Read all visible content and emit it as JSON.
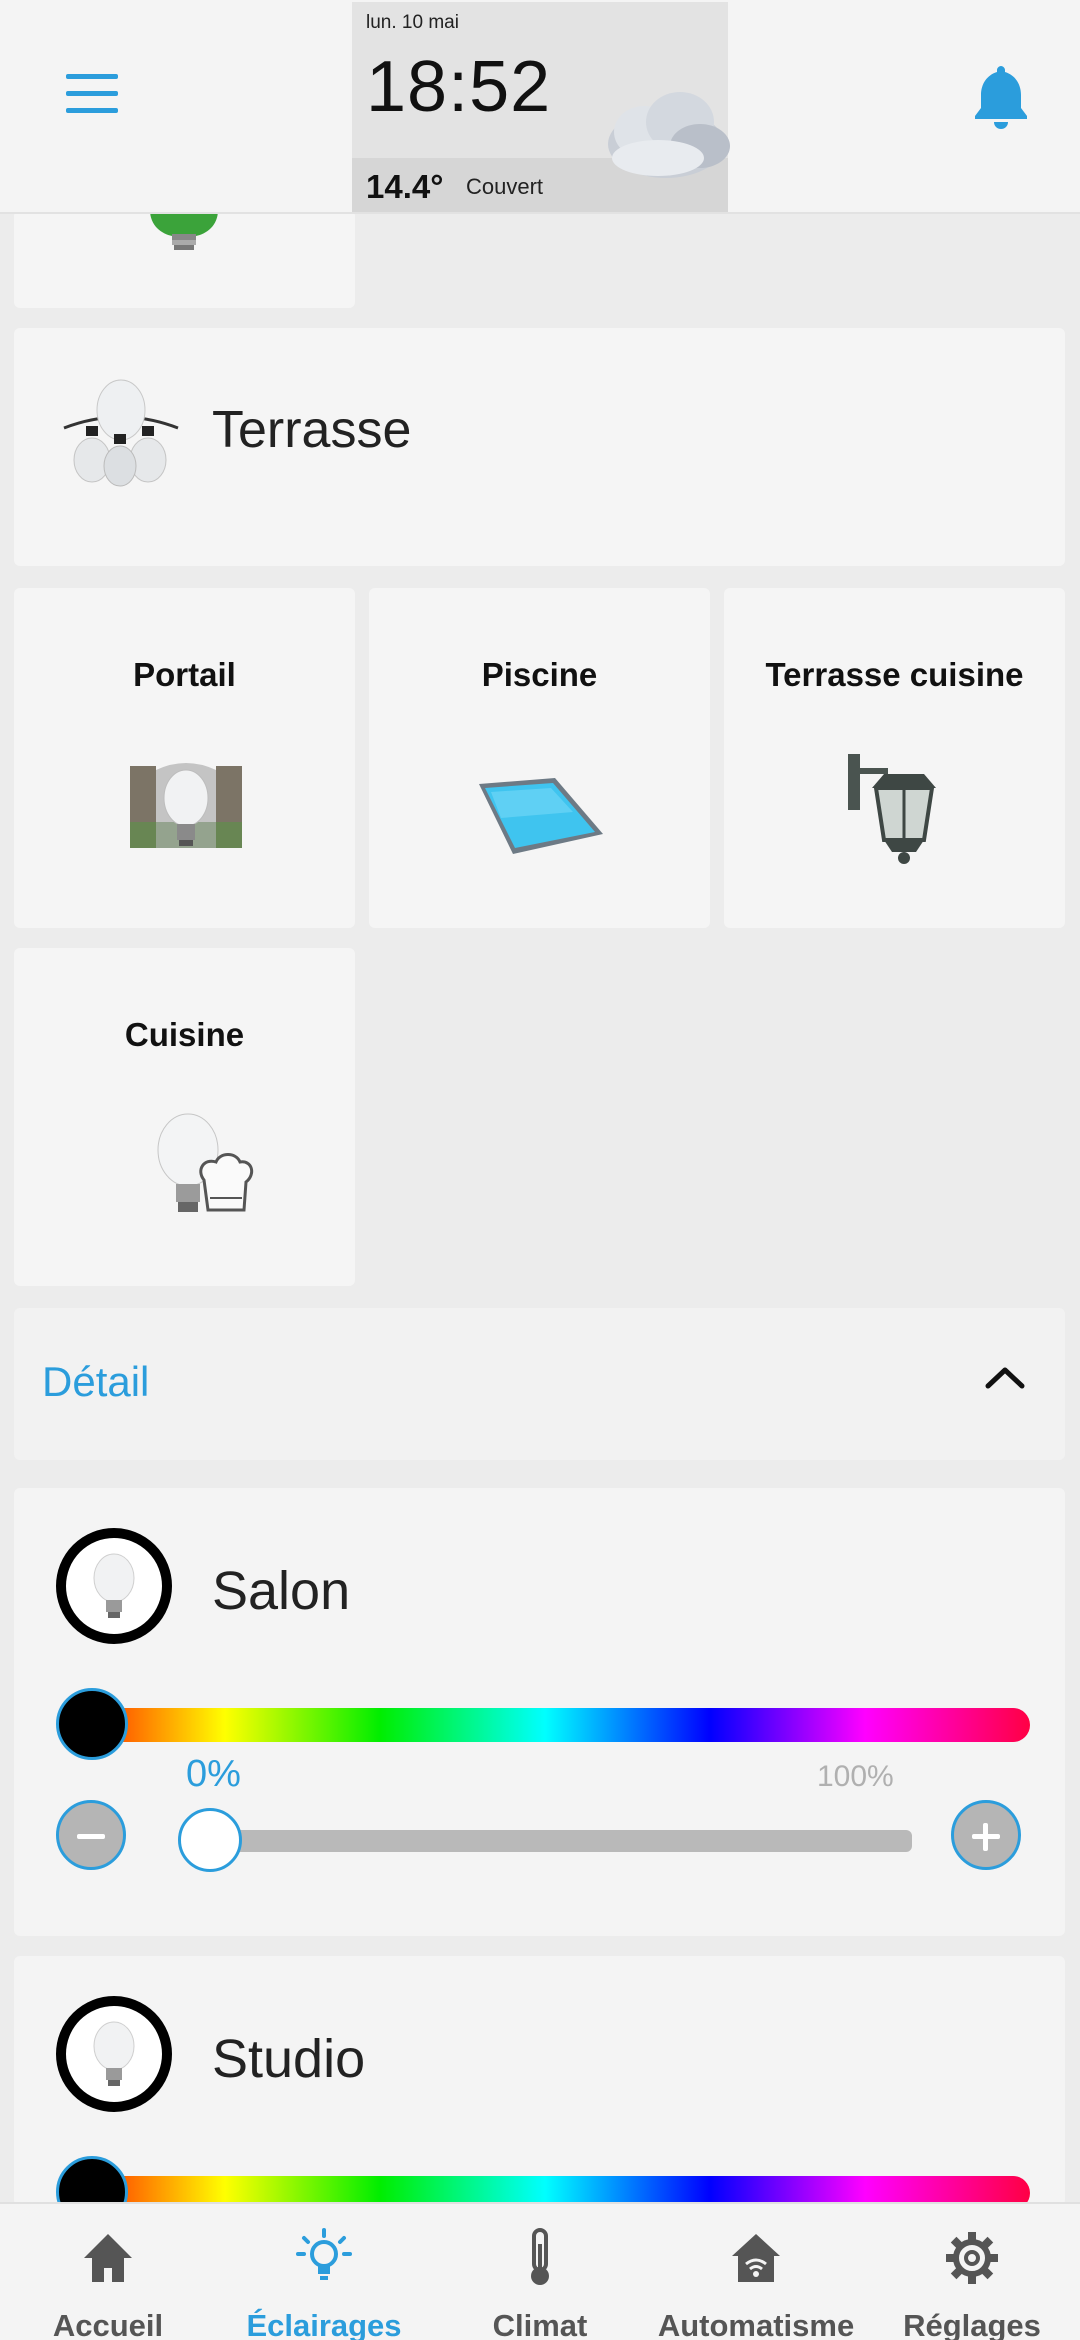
{
  "header": {
    "weather": {
      "date": "lun. 10 mai",
      "time": "18:52",
      "temperature": "14.4°",
      "condition": "Couvert",
      "icon": "cloud-icon"
    },
    "menu_icon": "hamburger-menu-icon",
    "notification_icon": "bell-icon"
  },
  "groups": {
    "terrasse": {
      "label": "Terrasse"
    }
  },
  "tiles": [
    {
      "label": "Portail",
      "icon": "gate-bulb-icon"
    },
    {
      "label": "Piscine",
      "icon": "pool-icon"
    },
    {
      "label": "Terrasse cuisine",
      "icon": "wall-lantern-icon"
    },
    {
      "label": "Cuisine",
      "icon": "chef-bulb-icon"
    }
  ],
  "detail": {
    "label": "Détail",
    "expanded": true
  },
  "devices": [
    {
      "name": "Salon",
      "color_position": 0,
      "brightness_label": "0%",
      "brightness_max_label": "100%",
      "brightness": 0
    },
    {
      "name": "Studio",
      "color_position": 0
    }
  ],
  "nav": {
    "items": [
      {
        "label": "Accueil",
        "icon": "home-icon",
        "active": false
      },
      {
        "label": "Éclairages",
        "icon": "lightbulb-icon",
        "active": true
      },
      {
        "label": "Climat",
        "icon": "thermometer-icon",
        "active": false
      },
      {
        "label": "Automatisme",
        "icon": "smart-home-icon",
        "active": false
      },
      {
        "label": "Réglages",
        "icon": "gear-icon",
        "active": false
      }
    ]
  },
  "colors": {
    "accent": "#2b9ddc",
    "card": "#f5f5f5",
    "background": "#ececec"
  }
}
